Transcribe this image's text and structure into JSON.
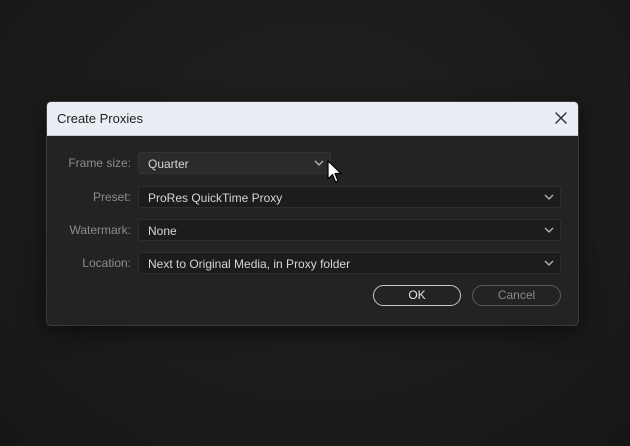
{
  "dialog": {
    "title": "Create Proxies",
    "close_icon": "close-icon"
  },
  "fields": {
    "frame_size": {
      "label": "Frame size:",
      "value": "Quarter"
    },
    "preset": {
      "label": "Preset:",
      "value": "ProRes QuickTime Proxy"
    },
    "watermark": {
      "label": "Watermark:",
      "value": "None"
    },
    "location": {
      "label": "Location:",
      "value": "Next to Original Media, in Proxy folder"
    }
  },
  "buttons": {
    "ok": "OK",
    "cancel": "Cancel"
  },
  "icons": {
    "dropdown": "chevron-down-icon",
    "pointer": "mouse-pointer-icon"
  },
  "colors": {
    "titlebar": "#e9eef4",
    "dialog_bg": "#232323",
    "field_bg": "#1c1c1c",
    "label_text": "#8c8c8c",
    "value_text": "#d6d6d6"
  }
}
